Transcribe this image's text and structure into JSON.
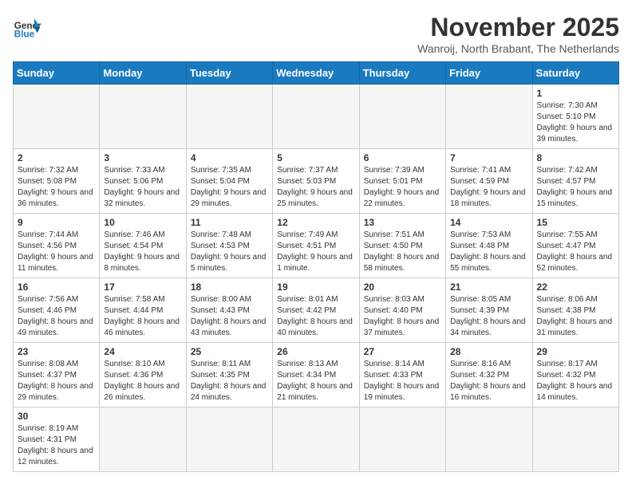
{
  "header": {
    "logo_general": "General",
    "logo_blue": "Blue",
    "month_title": "November 2025",
    "location": "Wanroij, North Brabant, The Netherlands"
  },
  "days_of_week": [
    "Sunday",
    "Monday",
    "Tuesday",
    "Wednesday",
    "Thursday",
    "Friday",
    "Saturday"
  ],
  "weeks": [
    [
      {
        "day": "",
        "info": ""
      },
      {
        "day": "",
        "info": ""
      },
      {
        "day": "",
        "info": ""
      },
      {
        "day": "",
        "info": ""
      },
      {
        "day": "",
        "info": ""
      },
      {
        "day": "",
        "info": ""
      },
      {
        "day": "1",
        "info": "Sunrise: 7:30 AM\nSunset: 5:10 PM\nDaylight: 9 hours and 39 minutes."
      }
    ],
    [
      {
        "day": "2",
        "info": "Sunrise: 7:32 AM\nSunset: 5:08 PM\nDaylight: 9 hours and 36 minutes."
      },
      {
        "day": "3",
        "info": "Sunrise: 7:33 AM\nSunset: 5:06 PM\nDaylight: 9 hours and 32 minutes."
      },
      {
        "day": "4",
        "info": "Sunrise: 7:35 AM\nSunset: 5:04 PM\nDaylight: 9 hours and 29 minutes."
      },
      {
        "day": "5",
        "info": "Sunrise: 7:37 AM\nSunset: 5:03 PM\nDaylight: 9 hours and 25 minutes."
      },
      {
        "day": "6",
        "info": "Sunrise: 7:39 AM\nSunset: 5:01 PM\nDaylight: 9 hours and 22 minutes."
      },
      {
        "day": "7",
        "info": "Sunrise: 7:41 AM\nSunset: 4:59 PM\nDaylight: 9 hours and 18 minutes."
      },
      {
        "day": "8",
        "info": "Sunrise: 7:42 AM\nSunset: 4:57 PM\nDaylight: 9 hours and 15 minutes."
      }
    ],
    [
      {
        "day": "9",
        "info": "Sunrise: 7:44 AM\nSunset: 4:56 PM\nDaylight: 9 hours and 11 minutes."
      },
      {
        "day": "10",
        "info": "Sunrise: 7:46 AM\nSunset: 4:54 PM\nDaylight: 9 hours and 8 minutes."
      },
      {
        "day": "11",
        "info": "Sunrise: 7:48 AM\nSunset: 4:53 PM\nDaylight: 9 hours and 5 minutes."
      },
      {
        "day": "12",
        "info": "Sunrise: 7:49 AM\nSunset: 4:51 PM\nDaylight: 9 hours and 1 minute."
      },
      {
        "day": "13",
        "info": "Sunrise: 7:51 AM\nSunset: 4:50 PM\nDaylight: 8 hours and 58 minutes."
      },
      {
        "day": "14",
        "info": "Sunrise: 7:53 AM\nSunset: 4:48 PM\nDaylight: 8 hours and 55 minutes."
      },
      {
        "day": "15",
        "info": "Sunrise: 7:55 AM\nSunset: 4:47 PM\nDaylight: 8 hours and 52 minutes."
      }
    ],
    [
      {
        "day": "16",
        "info": "Sunrise: 7:56 AM\nSunset: 4:46 PM\nDaylight: 8 hours and 49 minutes."
      },
      {
        "day": "17",
        "info": "Sunrise: 7:58 AM\nSunset: 4:44 PM\nDaylight: 8 hours and 46 minutes."
      },
      {
        "day": "18",
        "info": "Sunrise: 8:00 AM\nSunset: 4:43 PM\nDaylight: 8 hours and 43 minutes."
      },
      {
        "day": "19",
        "info": "Sunrise: 8:01 AM\nSunset: 4:42 PM\nDaylight: 8 hours and 40 minutes."
      },
      {
        "day": "20",
        "info": "Sunrise: 8:03 AM\nSunset: 4:40 PM\nDaylight: 8 hours and 37 minutes."
      },
      {
        "day": "21",
        "info": "Sunrise: 8:05 AM\nSunset: 4:39 PM\nDaylight: 8 hours and 34 minutes."
      },
      {
        "day": "22",
        "info": "Sunrise: 8:06 AM\nSunset: 4:38 PM\nDaylight: 8 hours and 31 minutes."
      }
    ],
    [
      {
        "day": "23",
        "info": "Sunrise: 8:08 AM\nSunset: 4:37 PM\nDaylight: 8 hours and 29 minutes."
      },
      {
        "day": "24",
        "info": "Sunrise: 8:10 AM\nSunset: 4:36 PM\nDaylight: 8 hours and 26 minutes."
      },
      {
        "day": "25",
        "info": "Sunrise: 8:11 AM\nSunset: 4:35 PM\nDaylight: 8 hours and 24 minutes."
      },
      {
        "day": "26",
        "info": "Sunrise: 8:13 AM\nSunset: 4:34 PM\nDaylight: 8 hours and 21 minutes."
      },
      {
        "day": "27",
        "info": "Sunrise: 8:14 AM\nSunset: 4:33 PM\nDaylight: 8 hours and 19 minutes."
      },
      {
        "day": "28",
        "info": "Sunrise: 8:16 AM\nSunset: 4:32 PM\nDaylight: 8 hours and 16 minutes."
      },
      {
        "day": "29",
        "info": "Sunrise: 8:17 AM\nSunset: 4:32 PM\nDaylight: 8 hours and 14 minutes."
      }
    ],
    [
      {
        "day": "30",
        "info": "Sunrise: 8:19 AM\nSunset: 4:31 PM\nDaylight: 8 hours and 12 minutes."
      },
      {
        "day": "",
        "info": ""
      },
      {
        "day": "",
        "info": ""
      },
      {
        "day": "",
        "info": ""
      },
      {
        "day": "",
        "info": ""
      },
      {
        "day": "",
        "info": ""
      },
      {
        "day": "",
        "info": ""
      }
    ]
  ]
}
